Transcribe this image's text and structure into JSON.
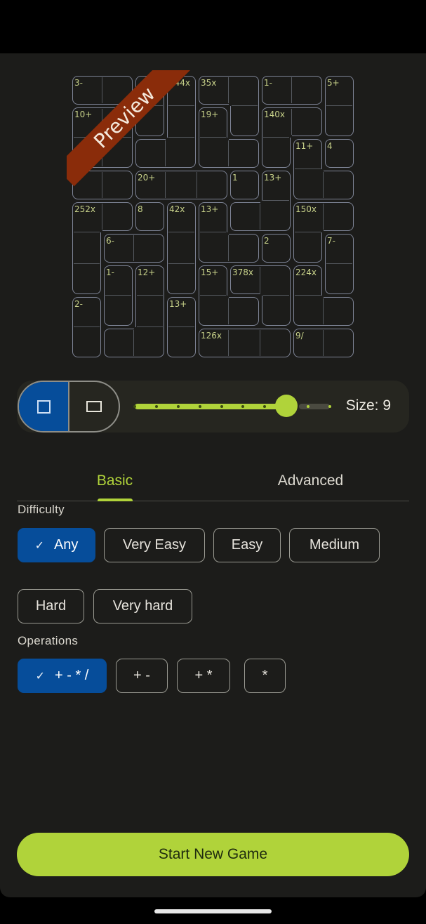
{
  "preview": {
    "banner_label": "Preview",
    "grid_size": 9,
    "cages": [
      {
        "label": "3-",
        "cells": [
          [
            0,
            0
          ],
          [
            0,
            1
          ]
        ]
      },
      {
        "label": "",
        "cells": [
          [
            0,
            2
          ],
          [
            1,
            2
          ]
        ]
      },
      {
        "label": "144x",
        "cells": [
          [
            0,
            3
          ],
          [
            1,
            3
          ],
          [
            2,
            2
          ],
          [
            2,
            3
          ]
        ]
      },
      {
        "label": "35x",
        "cells": [
          [
            0,
            4
          ],
          [
            0,
            5
          ],
          [
            1,
            5
          ]
        ]
      },
      {
        "label": "1-",
        "cells": [
          [
            0,
            6
          ],
          [
            0,
            7
          ]
        ]
      },
      {
        "label": "5+",
        "cells": [
          [
            0,
            8
          ],
          [
            1,
            8
          ]
        ]
      },
      {
        "label": "10+",
        "cells": [
          [
            1,
            0
          ],
          [
            1,
            1
          ],
          [
            2,
            0
          ],
          [
            2,
            1
          ]
        ]
      },
      {
        "label": "19+",
        "cells": [
          [
            1,
            4
          ],
          [
            2,
            4
          ],
          [
            2,
            5
          ]
        ]
      },
      {
        "label": "140x",
        "cells": [
          [
            1,
            6
          ],
          [
            1,
            7
          ],
          [
            2,
            6
          ]
        ]
      },
      {
        "label": "11+",
        "cells": [
          [
            2,
            7
          ],
          [
            3,
            7
          ],
          [
            3,
            8
          ]
        ]
      },
      {
        "label": "4",
        "cells": [
          [
            2,
            8
          ]
        ]
      },
      {
        "label": "",
        "cells": [
          [
            3,
            0
          ],
          [
            3,
            1
          ]
        ]
      },
      {
        "label": "20+",
        "cells": [
          [
            3,
            2
          ],
          [
            3,
            3
          ],
          [
            3,
            4
          ]
        ]
      },
      {
        "label": "1",
        "cells": [
          [
            3,
            5
          ]
        ]
      },
      {
        "label": "13+",
        "cells": [
          [
            3,
            6
          ],
          [
            4,
            5
          ],
          [
            4,
            6
          ]
        ]
      },
      {
        "label": "252x",
        "cells": [
          [
            4,
            0
          ],
          [
            4,
            1
          ],
          [
            5,
            0
          ],
          [
            6,
            0
          ]
        ]
      },
      {
        "label": "8",
        "cells": [
          [
            4,
            2
          ]
        ]
      },
      {
        "label": "42x",
        "cells": [
          [
            4,
            3
          ],
          [
            5,
            3
          ],
          [
            6,
            3
          ]
        ]
      },
      {
        "label": "13+",
        "cells": [
          [
            4,
            4
          ],
          [
            5,
            4
          ],
          [
            5,
            5
          ]
        ]
      },
      {
        "label": "150x",
        "cells": [
          [
            4,
            7
          ],
          [
            4,
            8
          ],
          [
            5,
            7
          ]
        ]
      },
      {
        "label": "6-",
        "cells": [
          [
            5,
            1
          ],
          [
            5,
            2
          ]
        ]
      },
      {
        "label": "2",
        "cells": [
          [
            5,
            6
          ]
        ]
      },
      {
        "label": "7-",
        "cells": [
          [
            5,
            8
          ],
          [
            6,
            8
          ]
        ]
      },
      {
        "label": "1-",
        "cells": [
          [
            6,
            1
          ],
          [
            7,
            1
          ]
        ]
      },
      {
        "label": "12+",
        "cells": [
          [
            6,
            2
          ],
          [
            7,
            2
          ],
          [
            8,
            1
          ],
          [
            8,
            2
          ]
        ]
      },
      {
        "label": "15+",
        "cells": [
          [
            6,
            4
          ],
          [
            7,
            4
          ],
          [
            7,
            5
          ]
        ]
      },
      {
        "label": "378x",
        "cells": [
          [
            6,
            5
          ],
          [
            6,
            6
          ],
          [
            7,
            6
          ]
        ]
      },
      {
        "label": "224x",
        "cells": [
          [
            6,
            7
          ],
          [
            7,
            7
          ],
          [
            7,
            8
          ]
        ]
      },
      {
        "label": "2-",
        "cells": [
          [
            7,
            0
          ],
          [
            8,
            0
          ]
        ]
      },
      {
        "label": "13+",
        "cells": [
          [
            7,
            3
          ],
          [
            8,
            3
          ]
        ]
      },
      {
        "label": "126x",
        "cells": [
          [
            8,
            4
          ],
          [
            8,
            5
          ],
          [
            8,
            6
          ]
        ]
      },
      {
        "label": "9/",
        "cells": [
          [
            8,
            7
          ],
          [
            8,
            8
          ]
        ]
      }
    ]
  },
  "size_control": {
    "shapes": [
      {
        "name": "square",
        "icon": "square-icon",
        "selected": true
      },
      {
        "name": "rectangle",
        "icon": "rectangle-icon",
        "selected": false
      }
    ],
    "slider": {
      "min": 2,
      "max": 11,
      "value": 9
    },
    "size_label": "Size: 9"
  },
  "tabs": [
    {
      "label": "Basic",
      "active": true
    },
    {
      "label": "Advanced",
      "active": false
    }
  ],
  "difficulty": {
    "label": "Difficulty",
    "options": [
      {
        "label": "Any",
        "selected": true
      },
      {
        "label": "Very Easy",
        "selected": false
      },
      {
        "label": "Easy",
        "selected": false
      },
      {
        "label": "Medium",
        "selected": false
      },
      {
        "label": "Hard",
        "selected": false
      },
      {
        "label": "Very hard",
        "selected": false
      }
    ]
  },
  "operations": {
    "label": "Operations",
    "options": [
      {
        "label": "+ - * /",
        "selected": true
      },
      {
        "label": "+ -",
        "selected": false
      },
      {
        "label": "+ *",
        "selected": false
      },
      {
        "label": "*",
        "selected": false
      }
    ]
  },
  "start_button": {
    "label": "Start New Game"
  },
  "colors": {
    "accent": "#b0d33a",
    "selected": "#064d9a",
    "banner": "#8a2c0a",
    "background": "#1c1c1a"
  }
}
